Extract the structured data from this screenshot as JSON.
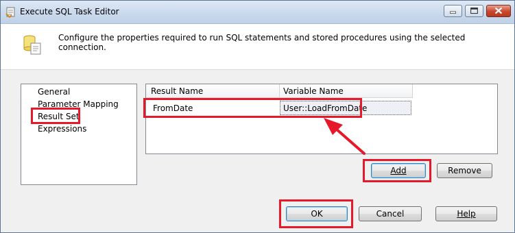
{
  "window": {
    "title": "Execute SQL Task Editor",
    "buttons": [
      "minimize-icon",
      "maximize-icon",
      "close-icon"
    ]
  },
  "header": {
    "description": "Configure the properties required to run SQL statements and stored procedures using the selected connection."
  },
  "nav": {
    "items": [
      {
        "label": "General"
      },
      {
        "label": "Parameter Mapping"
      },
      {
        "label": "Result Set"
      },
      {
        "label": "Expressions"
      }
    ],
    "selected": "Result Set"
  },
  "grid": {
    "columns": [
      "Result Name",
      "Variable Name"
    ],
    "rows": [
      {
        "result_name": "FromDate",
        "variable_name": "User::LoadFromDate"
      }
    ]
  },
  "actions": {
    "add_label": "Add",
    "remove_label": "Remove",
    "ok_label": "OK",
    "cancel_label": "Cancel",
    "help_label": "Help"
  },
  "annotation_color": "#e6192b"
}
